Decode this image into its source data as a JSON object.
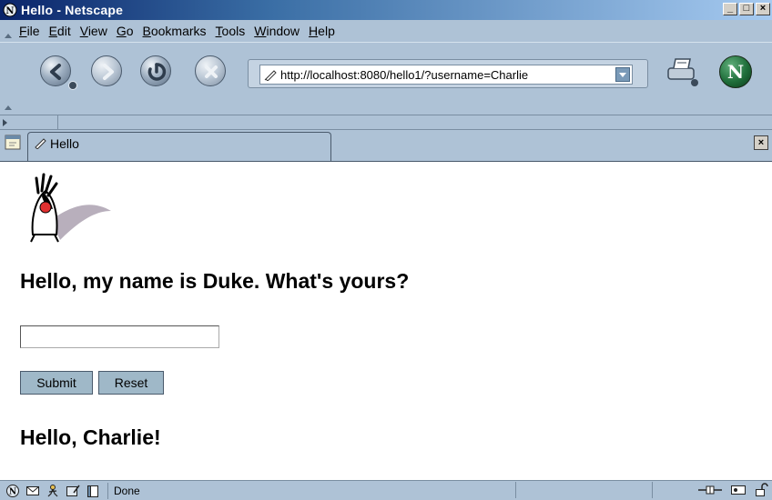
{
  "window": {
    "title": "Hello - Netscape",
    "controls": [
      "_",
      "□",
      "×"
    ]
  },
  "menu": [
    "File",
    "Edit",
    "View",
    "Go",
    "Bookmarks",
    "Tools",
    "Window",
    "Help"
  ],
  "toolbar": {
    "buttons": [
      "back-icon",
      "forward-icon",
      "reload-icon",
      "stop-icon"
    ],
    "url": "http://localhost:8080/hello1/?username=Charlie"
  },
  "tabs": [
    {
      "label": "Hello",
      "active": true
    }
  ],
  "content": {
    "heading": "Hello, my name is Duke. What's yours?",
    "input_value": "",
    "submit_label": "Submit",
    "reset_label": "Reset",
    "greeting": "Hello, Charlie!"
  },
  "status": {
    "text": "Done"
  },
  "colors": {
    "chrome": "#aec2d6",
    "titlebar_start": "#0a246a",
    "titlebar_end": "#a6caf0",
    "button": "#9fb8c8",
    "content_bg": "#ffffff"
  }
}
